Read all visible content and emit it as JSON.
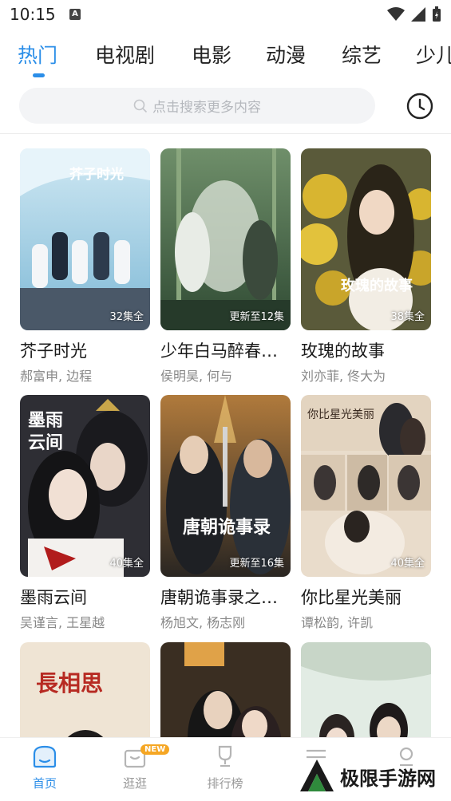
{
  "status_bar": {
    "time": "10:15",
    "notification_icon": "A"
  },
  "tabs": [
    {
      "label": "热门",
      "active": true
    },
    {
      "label": "电视剧",
      "active": false
    },
    {
      "label": "电影",
      "active": false
    },
    {
      "label": "动漫",
      "active": false
    },
    {
      "label": "综艺",
      "active": false
    },
    {
      "label": "少儿",
      "active": false
    }
  ],
  "search": {
    "placeholder": "点击搜索更多内容",
    "icon": "search-icon",
    "history_icon": "clock-icon"
  },
  "colors": {
    "accent": "#2b8ee8",
    "badge_new": "#f5a623",
    "text_secondary": "#888888"
  },
  "shows": [
    {
      "title": "芥子时光",
      "cast": "郝富申, 边程",
      "episodes": "32集全"
    },
    {
      "title": "少年白马醉春…",
      "cast": "侯明昊, 何与",
      "episodes": "更新至12集"
    },
    {
      "title": "玫瑰的故事",
      "cast": "刘亦菲, 佟大为",
      "episodes": "38集全"
    },
    {
      "title": "墨雨云间",
      "cast": "吴谨言, 王星越",
      "episodes": "40集全"
    },
    {
      "title": "唐朝诡事录之…",
      "cast": "杨旭文, 杨志刚",
      "episodes": "更新至16集"
    },
    {
      "title": "你比星光美丽",
      "cast": "谭松韵, 许凯",
      "episodes": "40集全"
    },
    {
      "title": "",
      "cast": "",
      "episodes": ""
    },
    {
      "title": "",
      "cast": "",
      "episodes": ""
    },
    {
      "title": "",
      "cast": "",
      "episodes": ""
    }
  ],
  "posters": {
    "p1": "芥子时光",
    "p3": "玫瑰的故事",
    "p4a": "墨雨",
    "p4b": "云间",
    "p5": "唐朝诡事录",
    "p6": "你比星光美丽",
    "p7": "長相思"
  },
  "bottom_nav": [
    {
      "label": "首页",
      "icon": "home-icon",
      "active": true
    },
    {
      "label": "逛逛",
      "icon": "shop-icon",
      "badge": "NEW",
      "active": false
    },
    {
      "label": "排行榜",
      "icon": "trophy-icon",
      "active": false
    },
    {
      "label": "",
      "icon": "menu-icon",
      "active": false
    },
    {
      "label": "",
      "icon": "profile-icon",
      "active": false
    }
  ],
  "watermark": {
    "text": "极限手游网"
  }
}
